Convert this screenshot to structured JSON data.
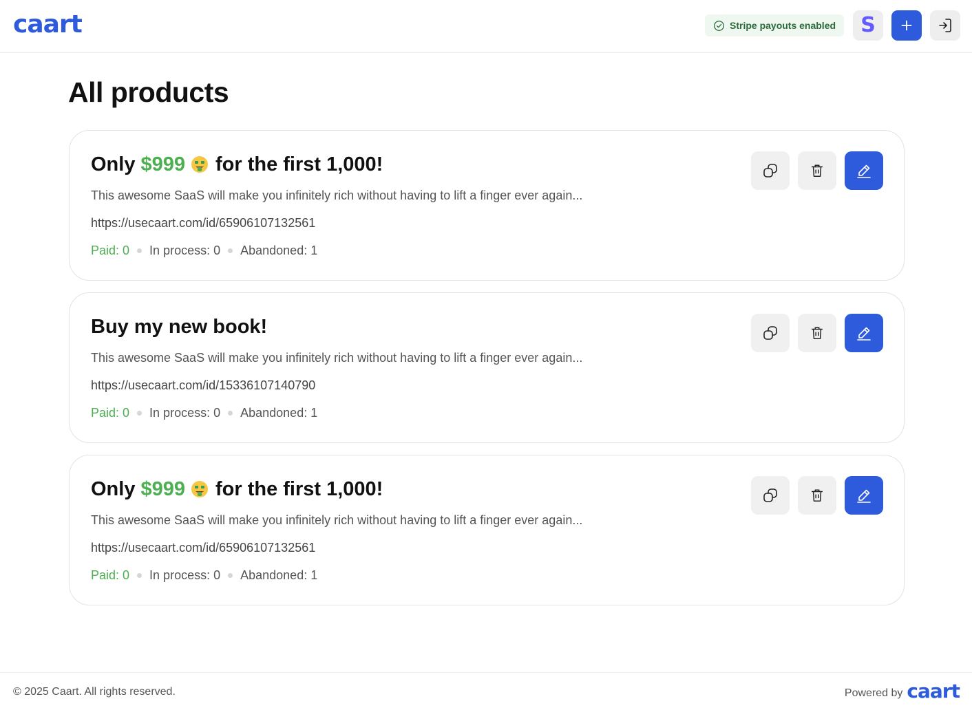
{
  "header": {
    "logo": "caart",
    "stripe_status": "Stripe payouts enabled",
    "stripe_letter": "S"
  },
  "page": {
    "title": "All products"
  },
  "products": [
    {
      "title_prefix": "Only",
      "price": "$999",
      "title_suffix": "for the first 1,000!",
      "has_emoji": true,
      "description": "This awesome SaaS will make you infinitely rich without having to lift a finger ever again...",
      "url": "https://usecaart.com/id/65906107132561",
      "paid": "Paid: 0",
      "in_process": "In process: 0",
      "abandoned": "Abandoned: 1"
    },
    {
      "title": "Buy my new book!",
      "has_emoji": false,
      "description": "This awesome SaaS will make you infinitely rich without having to lift a finger ever again...",
      "url": "https://usecaart.com/id/15336107140790",
      "paid": "Paid: 0",
      "in_process": "In process: 0",
      "abandoned": "Abandoned: 1"
    },
    {
      "title_prefix": "Only",
      "price": "$999",
      "title_suffix": "for the first 1,000!",
      "has_emoji": true,
      "description": "This awesome SaaS will make you infinitely rich without having to lift a finger ever again...",
      "url": "https://usecaart.com/id/65906107132561",
      "paid": "Paid: 0",
      "in_process": "In process: 0",
      "abandoned": "Abandoned: 1"
    }
  ],
  "footer": {
    "copyright": "© 2025 Caart. All rights reserved.",
    "powered_by": "Powered by",
    "logo": "caart"
  },
  "icons": {
    "stripe_status": "check-circle-icon",
    "stripe": "stripe-logo-icon",
    "add": "plus-icon",
    "login": "login-icon",
    "duplicate": "copy-icon",
    "delete": "trash-icon",
    "edit": "pencil-icon",
    "emoji": "money-mouth-face-icon"
  },
  "colors": {
    "brand": "#2e5bdc",
    "price_green": "#4caf50",
    "stripe_purple": "#635bff",
    "badge_bg": "#eef8f0"
  }
}
